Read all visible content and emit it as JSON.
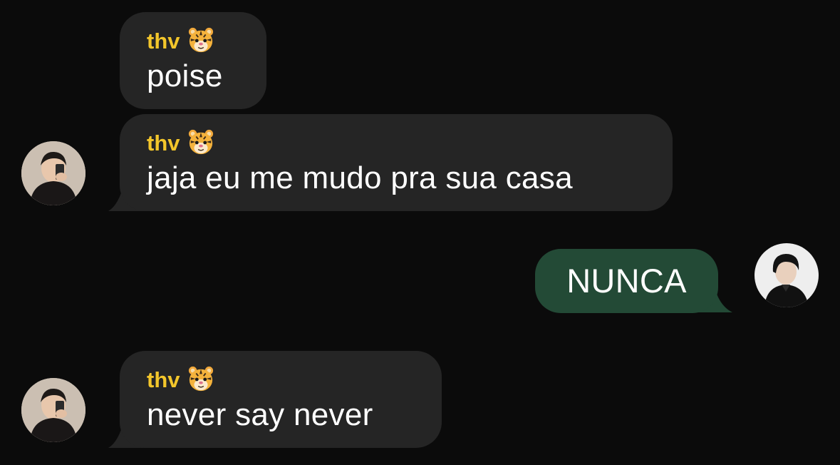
{
  "messages": [
    {
      "sender": "thv",
      "text": "poise"
    },
    {
      "sender": "thv",
      "text": "jaja eu me mudo pra sua casa"
    },
    {
      "text": "NUNCA"
    },
    {
      "sender": "thv",
      "text": "never say never"
    }
  ],
  "icons": {
    "sender_emoji": "tiger-face-icon",
    "incoming_avatar": "contact-avatar-photo",
    "outgoing_avatar": "self-avatar-photo"
  },
  "colors": {
    "background": "#0b0b0b",
    "incoming_bubble": "#252525",
    "outgoing_bubble": "#234a36",
    "sender_name": "#f3c62b",
    "message_text": "#ffffff"
  }
}
